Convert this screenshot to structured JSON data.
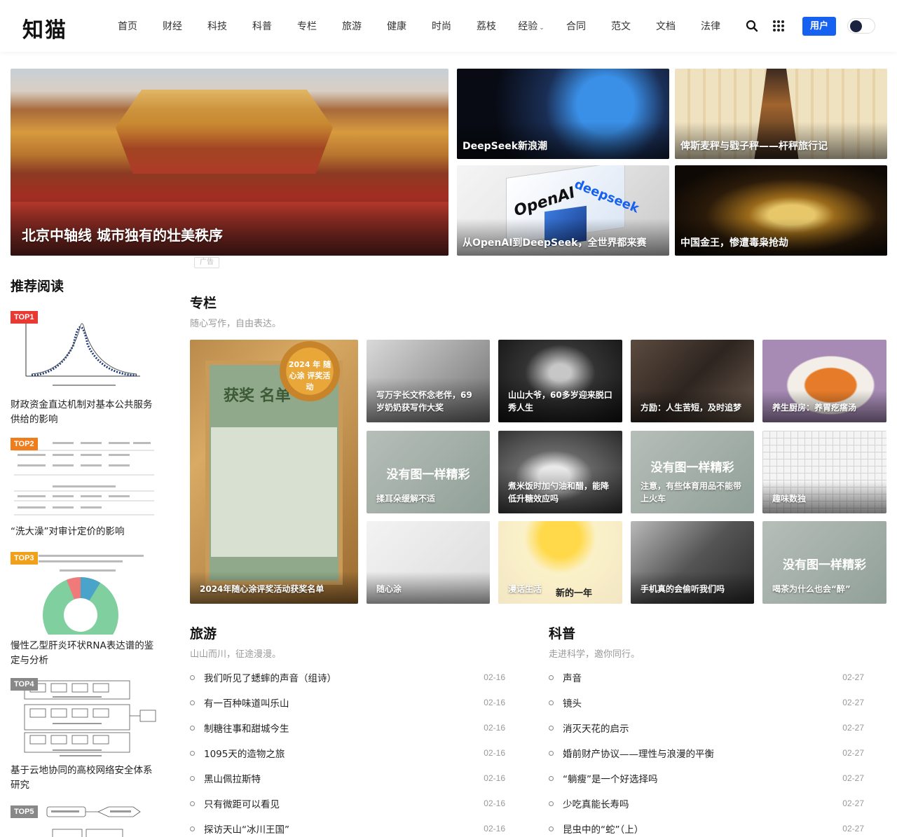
{
  "site": {
    "logo": "知猫"
  },
  "nav": {
    "items": [
      "首页",
      "财经",
      "科技",
      "科普",
      "专栏",
      "旅游",
      "健康",
      "时尚",
      "荔枝",
      "经验",
      "合同",
      "范文",
      "文档",
      "法律"
    ],
    "user_label": "用户",
    "icons": [
      "search-icon",
      "apps-grid-icon",
      "theme-toggle"
    ]
  },
  "hero": {
    "main_caption": "北京中轴线 城市独有的壮美秩序",
    "ad_label": "广告",
    "tiles": [
      {
        "caption": "DeepSeek新浪潮"
      },
      {
        "caption": "俾斯麦秤与戥子秤——杆秤旅行记"
      },
      {
        "caption": "从OpenAI到DeepSeek，全世界都来赛",
        "art_text_1": "OpenAI",
        "art_text_2": "deepseek"
      },
      {
        "caption": "中国金王，惨遭毒枭抢劫"
      }
    ]
  },
  "sidebar": {
    "title": "推荐阅读",
    "items": [
      {
        "badge": "TOP1",
        "title": "财政资金直达机制对基本公共服务供给的影响"
      },
      {
        "badge": "TOP2",
        "title": "“洗大澡”对审计定价的影响"
      },
      {
        "badge": "TOP3",
        "title": "慢性乙型肝炎环状RNA表达谱的鉴定与分析"
      },
      {
        "badge": "TOP4",
        "title": "基于云地协同的高校网络安全体系研究"
      },
      {
        "badge": "TOP5",
        "title": ""
      }
    ]
  },
  "column": {
    "title": "专栏",
    "subtitle": "随心写作，自由表达。",
    "big_card": {
      "caption": "2024年随心涂评奖活动获奖名单",
      "seal_text": "2024 年 随心涂 评奖活动",
      "heading": "获奖 名单"
    },
    "cards": [
      {
        "caption": "写万字长文怀念老伴，69岁奶奶获写作大奖"
      },
      {
        "caption": "山山大爷，60多岁迎来脱口秀人生"
      },
      {
        "caption": "方励：人生苦短，及时追梦"
      },
      {
        "caption": "养生厨房：养胃疙瘩汤"
      },
      {
        "caption": "揉耳朵缓解不适",
        "placeholder": "没有图一样精彩"
      },
      {
        "caption": "煮米饭时加勺油和醋，能降低升糖效应吗"
      },
      {
        "caption": "注意，有些体育用品不能带上火车",
        "placeholder": "没有图一样精彩"
      },
      {
        "caption": "趣味数独"
      },
      {
        "caption": "随心涂"
      },
      {
        "caption": "漫话生活",
        "art_text": "新的一年"
      },
      {
        "caption": "手机真的会偷听我们吗"
      },
      {
        "caption": "喝茶为什么也会“醉”",
        "placeholder": "没有图一样精彩"
      }
    ]
  },
  "travel": {
    "title": "旅游",
    "subtitle": "山山而川，征途漫漫。",
    "items": [
      {
        "title": "我们听见了蟋蟀的声音（组诗）",
        "date": "02-16"
      },
      {
        "title": "有一百种味道叫乐山",
        "date": "02-16"
      },
      {
        "title": "制糖往事和甜城今生",
        "date": "02-16"
      },
      {
        "title": "1095天的造物之旅",
        "date": "02-16"
      },
      {
        "title": "黑山佩拉斯特",
        "date": "02-16"
      },
      {
        "title": "只有微距可以看见",
        "date": "02-16"
      },
      {
        "title": "探访天山“冰川王国”",
        "date": "02-16"
      }
    ]
  },
  "science": {
    "title": "科普",
    "subtitle": "走进科学，邀你同行。",
    "items": [
      {
        "title": "声音",
        "date": "02-27"
      },
      {
        "title": "镜头",
        "date": "02-27"
      },
      {
        "title": "消灭天花的启示",
        "date": "02-27"
      },
      {
        "title": "婚前财产协议——理性与浪漫的平衡",
        "date": "02-27"
      },
      {
        "title": "“躺瘦”是一个好选择吗",
        "date": "02-27"
      },
      {
        "title": "少吃真能长寿吗",
        "date": "02-27"
      },
      {
        "title": "昆虫中的“蛇”（上）",
        "date": "02-27"
      }
    ]
  },
  "colors": {
    "accent": "#1761f0",
    "top1": "#e83a32",
    "top2": "#f07d1c",
    "top3": "#f0a019",
    "toggle_knob": "#1a2340"
  }
}
